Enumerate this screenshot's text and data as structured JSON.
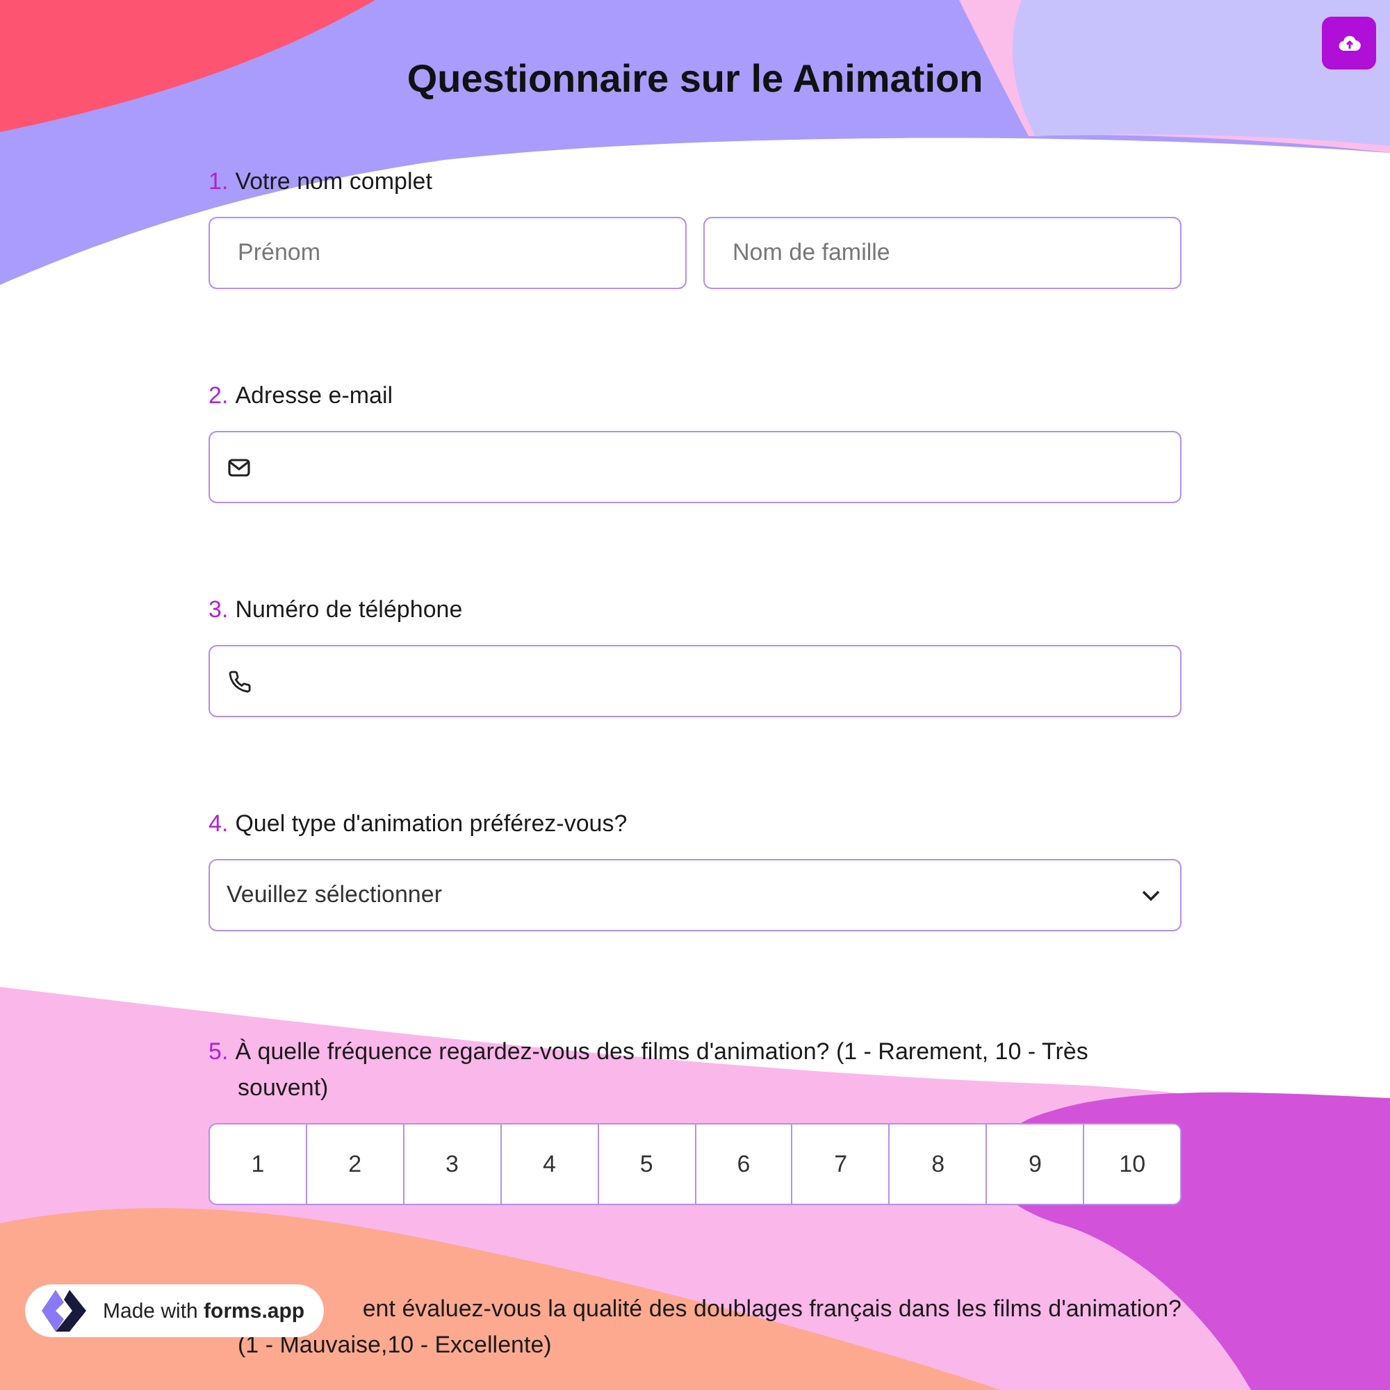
{
  "title": "Questionnaire sur le Animation",
  "questions": [
    {
      "kind": "name",
      "number": "1.",
      "label": "Votre nom complet",
      "fields": [
        {
          "placeholder": "Prénom"
        },
        {
          "placeholder": "Nom de famille"
        }
      ]
    },
    {
      "kind": "email",
      "number": "2.",
      "label": "Adresse e-mail"
    },
    {
      "kind": "phone",
      "number": "3.",
      "label": "Numéro de téléphone"
    },
    {
      "kind": "select",
      "number": "4.",
      "label": "Quel type d'animation préférez-vous?",
      "value": "Veuillez sélectionner"
    },
    {
      "kind": "scale",
      "number": "5.",
      "label": "À quelle fréquence regardez-vous des films d'animation? (1 - Rarement, 10 - Très souvent)",
      "options": [
        "1",
        "2",
        "3",
        "4",
        "5",
        "6",
        "7",
        "8",
        "9",
        "10"
      ]
    },
    {
      "kind": "partial",
      "lines": [
        "ent évaluez-vous la qualité des doublages français dans les films d'animation?",
        "(1 - Mauvaise,10 - Excellente)"
      ]
    }
  ],
  "badge": {
    "prefix": "Made with",
    "brand": "forms.app"
  }
}
